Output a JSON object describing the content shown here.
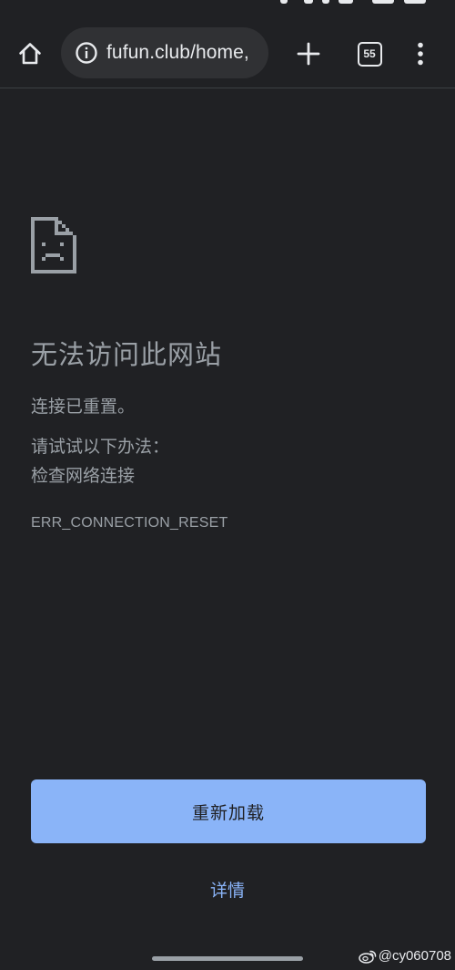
{
  "browser": {
    "url": "fufun.club/home,",
    "tab_count": "55"
  },
  "error_page": {
    "title": "无法访问此网站",
    "description": "连接已重置。",
    "suggestions_heading": "请试试以下办法：",
    "suggestions": [
      "检查网络连接"
    ],
    "error_code": "ERR_CONNECTION_RESET",
    "reload_label": "重新加载",
    "details_label": "详情"
  },
  "watermark": {
    "handle": "@cy060708",
    "icon": "weibo-logo"
  },
  "icons": {
    "home": "home-icon",
    "site_info": "info-icon",
    "new_tab": "plus-icon",
    "tab_switcher": "tab-switcher-icon",
    "menu": "kebab-menu-icon",
    "error": "sad-document-icon"
  },
  "colors": {
    "background": "#202124",
    "omnibox": "#303134",
    "text": "#9aa0a6",
    "icon": "#e8eaed",
    "accent": "#8ab4f8"
  }
}
